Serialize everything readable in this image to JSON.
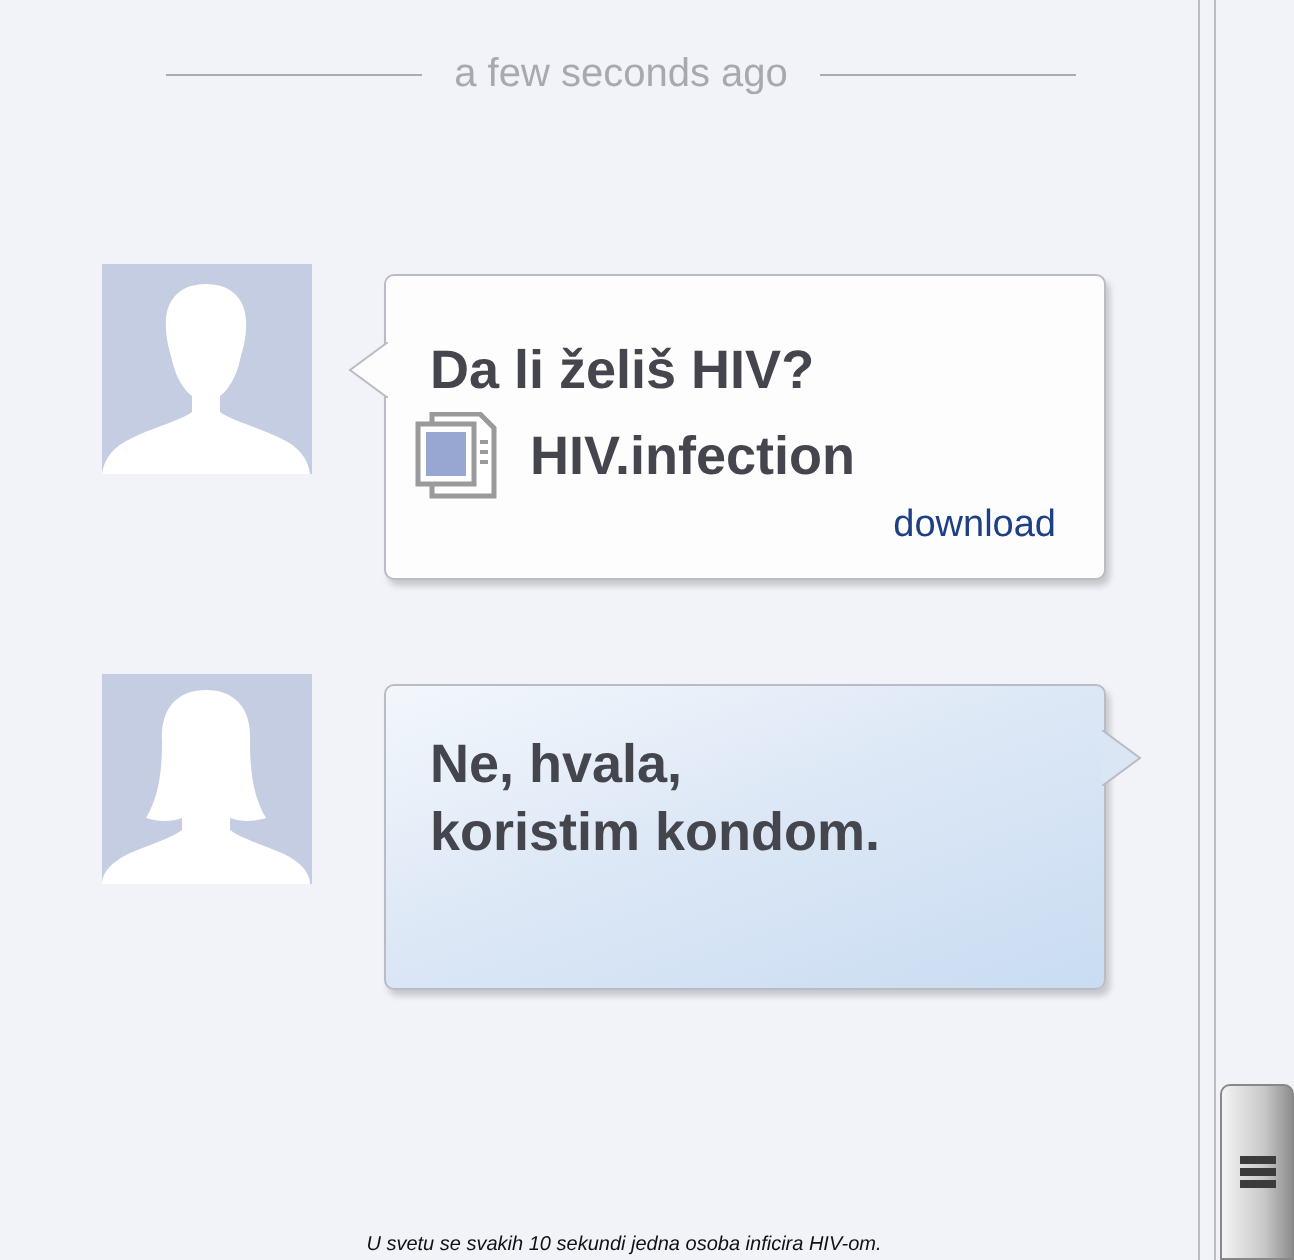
{
  "timestamp": "a few seconds ago",
  "messages": [
    {
      "kind": "received",
      "avatar": {
        "kind": "short_hair"
      },
      "lines": [
        "Da li želiš HIV?"
      ],
      "attachment": {
        "name": "HIV.infection",
        "link": "download"
      }
    },
    {
      "kind": "sent",
      "avatar": {
        "kind": "long_hair"
      },
      "lines": [
        "Ne, hvala,",
        "koristim kondom."
      ]
    }
  ],
  "footer": "U svetu se svakih 10 sekundi jedna osoba inficira HIV-om."
}
